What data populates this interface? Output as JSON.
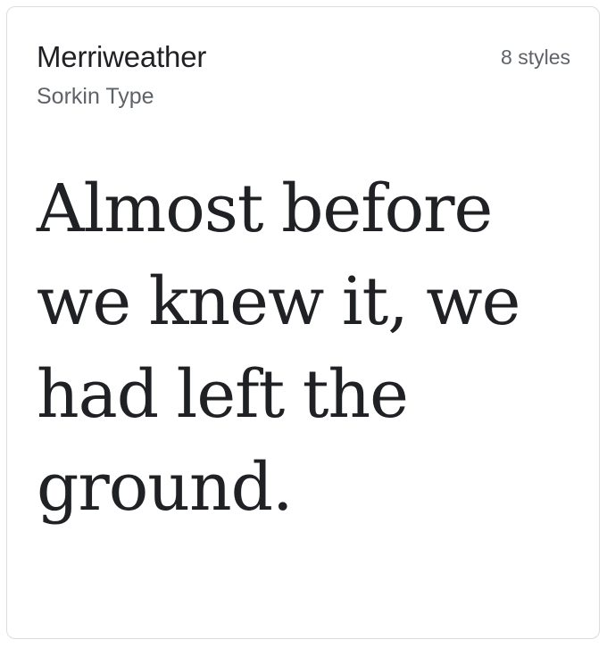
{
  "card": {
    "family_name": "Merriweather",
    "designer": "Sorkin Type",
    "styles_count": "8 styles",
    "sample_text": "Almost before we knew it, we had left the ground."
  },
  "colors": {
    "card_border": "#dadce0",
    "primary_text": "#202124",
    "secondary_text": "#5f6368"
  }
}
